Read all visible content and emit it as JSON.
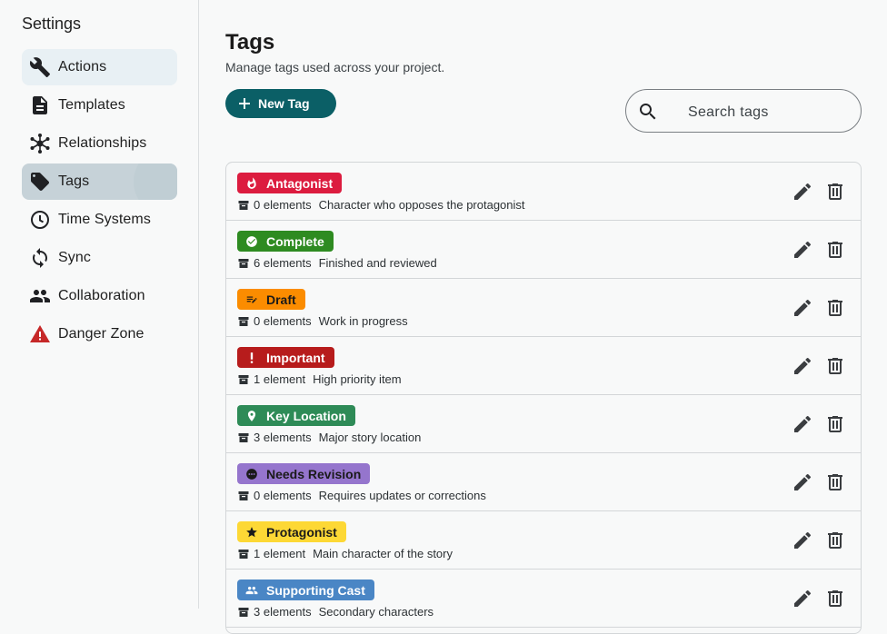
{
  "sidebar": {
    "title": "Settings",
    "items": [
      {
        "label": "Actions",
        "icon": "wrench-icon"
      },
      {
        "label": "Templates",
        "icon": "document-icon"
      },
      {
        "label": "Relationships",
        "icon": "hub-icon"
      },
      {
        "label": "Tags",
        "icon": "tag-icon"
      },
      {
        "label": "Time Systems",
        "icon": "clock-icon"
      },
      {
        "label": "Sync",
        "icon": "sync-icon"
      },
      {
        "label": "Collaboration",
        "icon": "people-icon"
      },
      {
        "label": "Danger Zone",
        "icon": "warning-icon"
      }
    ]
  },
  "main": {
    "title": "Tags",
    "subtitle": "Manage tags used across your project.",
    "new_tag_label": "New Tag",
    "search_placeholder": "Search tags",
    "tags": [
      {
        "name": "Antagonist",
        "count": "0 elements",
        "description": "Character who opposes the protagonist",
        "color": "#dc1c3f",
        "text_color": "#ffffff",
        "icon": "fire-icon"
      },
      {
        "name": "Complete",
        "count": "6 elements",
        "description": "Finished and reviewed",
        "color": "#2e8b21",
        "text_color": "#ffffff",
        "icon": "check-circle-icon"
      },
      {
        "name": "Draft",
        "count": "0 elements",
        "description": "Work in progress",
        "color": "#fb8c00",
        "text_color": "#1a1a1a",
        "icon": "edit-note-icon"
      },
      {
        "name": "Important",
        "count": "1 element",
        "description": "High priority item",
        "color": "#b71c1c",
        "text_color": "#ffffff",
        "icon": "exclamation-icon"
      },
      {
        "name": "Key Location",
        "count": "3 elements",
        "description": "Major story location",
        "color": "#2e8b57",
        "text_color": "#ffffff",
        "icon": "location-pin-icon"
      },
      {
        "name": "Needs Revision",
        "count": "0 elements",
        "description": "Requires updates or corrections",
        "color": "#9575cd",
        "text_color": "#1a1a1a",
        "icon": "more-circle-icon"
      },
      {
        "name": "Protagonist",
        "count": "1 element",
        "description": "Main character of the story",
        "color": "#fdd835",
        "text_color": "#1a1a1a",
        "icon": "star-icon"
      },
      {
        "name": "Supporting Cast",
        "count": "3 elements",
        "description": "Secondary characters",
        "color": "#4a86c5",
        "text_color": "#ffffff",
        "icon": "people-icon"
      }
    ]
  },
  "colors": {
    "accent": "#0b5f66",
    "active_nav": "#c6d2d8",
    "hover_nav": "#e8f0f4",
    "warning": "#c62828"
  }
}
